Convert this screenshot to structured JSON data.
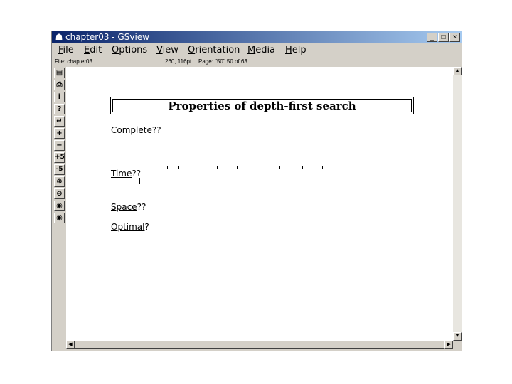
{
  "window": {
    "title": "chapter03 - GSview",
    "title_icon": "ghost-icon",
    "controls": [
      "_",
      "□",
      "×"
    ]
  },
  "menu": {
    "items": [
      {
        "underline": "F",
        "rest": "ile"
      },
      {
        "underline": "E",
        "rest": "dit"
      },
      {
        "underline": "O",
        "rest": "ptions"
      },
      {
        "underline": "V",
        "rest": "iew"
      },
      {
        "underline": "O",
        "rest": "rientation"
      },
      {
        "underline": "M",
        "rest": "edia"
      },
      {
        "underline": "H",
        "rest": "elp"
      }
    ]
  },
  "status": {
    "file": "File: chapter03",
    "coords": "260, 116pt",
    "page": "Page: \"50\"  50 of 63"
  },
  "toolbar": {
    "buttons": [
      {
        "name": "open-icon",
        "glyph": "▤"
      },
      {
        "name": "print-icon",
        "glyph": "⎙"
      },
      {
        "name": "info-icon",
        "glyph": "i"
      },
      {
        "name": "help-icon",
        "glyph": "?"
      },
      {
        "name": "goto-page-icon",
        "glyph": "↵"
      },
      {
        "name": "next-page-icon",
        "glyph": "+"
      },
      {
        "name": "prev-page-icon",
        "glyph": "−"
      },
      {
        "name": "skip-forward-icon",
        "glyph": "+5"
      },
      {
        "name": "skip-back-icon",
        "glyph": "-5"
      },
      {
        "name": "zoom-in-icon",
        "glyph": "⊕"
      },
      {
        "name": "zoom-out-icon",
        "glyph": "⊖"
      },
      {
        "name": "magnify-icon",
        "glyph": "◉"
      },
      {
        "name": "magnify-2-icon",
        "glyph": "◉"
      }
    ]
  },
  "slide": {
    "title": "Properties of depth-first search",
    "properties": [
      {
        "label": "Complete",
        "suffix": "??"
      },
      {
        "label": "Time",
        "suffix": "??"
      },
      {
        "label": "Space",
        "suffix": "??"
      },
      {
        "label": "Optimal",
        "suffix": "?"
      }
    ]
  }
}
